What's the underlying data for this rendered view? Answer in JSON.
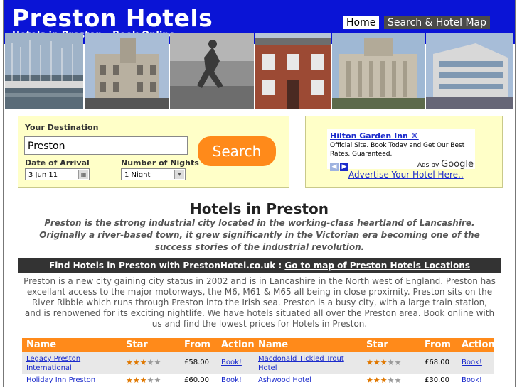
{
  "header": {
    "title": "Preston Hotels",
    "subtitle": "Hotels in Preston - Book Online.",
    "nav": {
      "home": "Home",
      "search_map": "Search & Hotel Map"
    }
  },
  "search": {
    "destination_label": "Your Destination",
    "destination_value": "Preston",
    "arrival_label": "Date of Arrival",
    "arrival_value": "3 Jun 11",
    "nights_label": "Number of Nights",
    "nights_value": "1 Night",
    "search_button": "Search"
  },
  "ad": {
    "title": "Hilton Garden Inn ®",
    "text": "Official Site. Book Today and Get Our Best Rates. Guaranteed.",
    "ads_by": "Ads by",
    "google": "Google",
    "advertise_link": "Advertise Your Hotel Here.."
  },
  "main": {
    "heading": "Hotels in Preston",
    "intro": "Preston is the strong industrial city located in the working-class heartland of Lancashire. Originally a river-based town, it grew significantly in the Victorian era becoming one of the success stories of the industrial revolution.",
    "findbar_text": "Find Hotels in Preston with PrestonHotel.co.uk :",
    "findbar_link": "Go to map of Preston Hotels Locations",
    "description": "Preston is a new city gaining city status in 2002 and is in Lancashire in the North west of England. Preston has excellant access to the major motorways, the M6, M61 & M65 all being in close proximity. Preston sits on the River Ribble which runs through Preston into the Irish sea. Preston is a busy city, with a large train station, and is renowened for its exciting nightlife. We have hotels situated all over the Preston area. Book online with us and find the lowest prices for Hotels in Preston."
  },
  "table": {
    "headers": [
      "Name",
      "Star",
      "From",
      "Action",
      "Name",
      "Star",
      "From",
      "Action"
    ],
    "rows": [
      {
        "left": {
          "name": "Legacy Preston International",
          "stars": 3,
          "price": "£58.00",
          "action": "Book!"
        },
        "right": {
          "name": "Macdonald Tickled Trout Hotel",
          "stars": 3,
          "price": "£68.00",
          "action": "Book!"
        }
      },
      {
        "left": {
          "name": "Holiday Inn Preston",
          "stars": 3,
          "price": "£60.00",
          "action": "Book!"
        },
        "right": {
          "name": "Ashwood Hotel",
          "stars": 3,
          "price": "£30.00",
          "action": "Book!"
        }
      }
    ]
  },
  "colors": {
    "header_blue": "#0a14d6",
    "accent_orange": "#ff8a1a",
    "box_yellow": "#ffffc8",
    "link_blue": "#1a2acc"
  }
}
